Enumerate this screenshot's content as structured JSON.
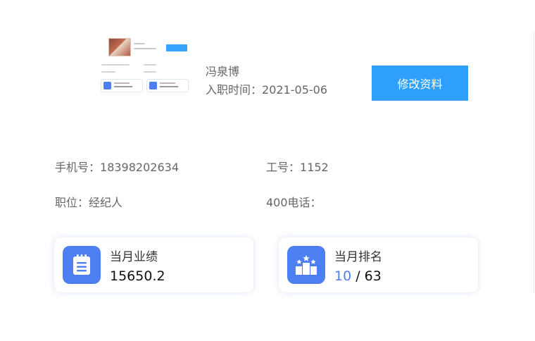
{
  "profile": {
    "name": "冯泉博",
    "entry_label": "入职时间：",
    "entry_date": "2021-05-06",
    "edit_button": "修改资料"
  },
  "info": {
    "phone_label": "手机号：",
    "phone_value": "18398202634",
    "job_no_label": "工号：",
    "job_no_value": "1152",
    "position_label": "职位：",
    "position_value": "经纪人",
    "tel400_label": "400电话：",
    "tel400_value": ""
  },
  "stats": {
    "performance": {
      "label": "当月业绩",
      "value": "15650.2",
      "icon": "notepad-icon"
    },
    "ranking": {
      "label": "当月排名",
      "rank": "10",
      "separator": " / ",
      "total": "63",
      "icon": "podium-icon"
    }
  },
  "colors": {
    "accent_button": "#2ea0fb",
    "icon_bg": "#4e7ff2",
    "rank_highlight": "#4e7ff2"
  }
}
